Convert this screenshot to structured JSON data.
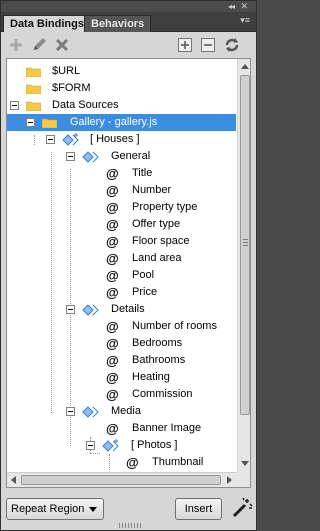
{
  "window": {
    "collapse_glyph": "◂◂",
    "close_glyph": "✕",
    "menu_glyph": "▾≡"
  },
  "tabs": [
    {
      "label": "Data Bindings",
      "active": true
    },
    {
      "label": "Behaviors",
      "active": false
    }
  ],
  "toolbar": {
    "buttons": [
      "add-icon",
      "pencil-icon",
      "delete-icon",
      "expand-all-icon",
      "collapse-all-icon",
      "refresh-icon"
    ]
  },
  "tree": {
    "url": "$URL",
    "form": "$FORM",
    "datasources": "Data Sources",
    "gallery": "Gallery - gallery.js",
    "houses": "[ Houses ]",
    "general": "General",
    "title": "Title",
    "number": "Number",
    "property_type": "Property type",
    "offer_type": "Offer type",
    "floor_space": "Floor space",
    "land_area": "Land area",
    "pool": "Pool",
    "price": "Price",
    "details": "Details",
    "number_of_rooms": "Number of rooms",
    "bedrooms": "Bedrooms",
    "bathrooms": "Bathrooms",
    "heating": "Heating",
    "commission": "Commission",
    "media": "Media",
    "banner_image": "Banner Image",
    "photos": "[ Photos ]",
    "thumbnail": "Thumbnail",
    "field_glyph": "@"
  },
  "bottom": {
    "dropdown_value": "Repeat Region",
    "insert_label": "Insert"
  },
  "colors": {
    "selection": "#3b8de0",
    "panel": "#d6d6d6",
    "tab_bar": "#3f3f3f",
    "diamond": "#3a7fcf",
    "folder": "#f2c94c"
  }
}
